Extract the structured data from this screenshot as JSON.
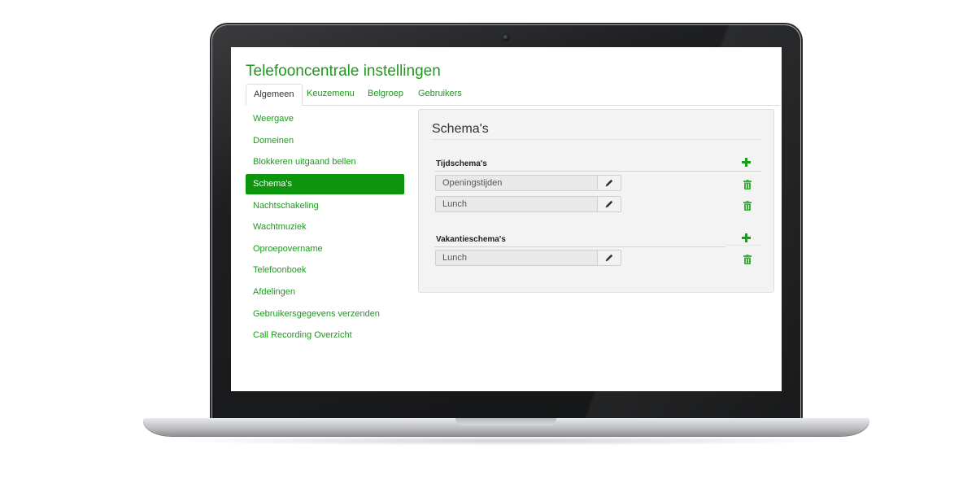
{
  "app": {
    "title": "Telefooncentrale instellingen"
  },
  "tabs": [
    {
      "label": "Algemeen",
      "active": true
    },
    {
      "label": "Keuzemenu",
      "active": false
    },
    {
      "label": "Belgroep",
      "active": false
    },
    {
      "label": "Gebruikers",
      "active": false
    }
  ],
  "sidebar": {
    "items": [
      {
        "label": "Weergave"
      },
      {
        "label": "Domeinen"
      },
      {
        "label": "Blokkeren uitgaand bellen"
      },
      {
        "label": "Schema's",
        "active": true
      },
      {
        "label": "Nachtschakeling"
      },
      {
        "label": "Wachtmuziek"
      },
      {
        "label": "Oproepovername"
      },
      {
        "label": "Telefoonboek"
      },
      {
        "label": "Afdelingen"
      },
      {
        "label": "Gebruikersgegevens verzenden"
      },
      {
        "label": "Call Recording Overzicht"
      }
    ]
  },
  "panel": {
    "title": "Schema's",
    "sections": [
      {
        "label": "Tijdschema's",
        "rows": [
          {
            "value": "Openingstijden"
          },
          {
            "value": "Lunch"
          }
        ]
      },
      {
        "label": "Vakantieschema's",
        "rows": [
          {
            "value": "Lunch"
          }
        ]
      }
    ]
  },
  "icons": {
    "add": "plus-icon",
    "delete": "trash-icon",
    "edit": "pencil-icon"
  },
  "colors": {
    "accent": "#1d9a1d",
    "active_bg": "#0d950d",
    "delete": "#3cae3c"
  }
}
